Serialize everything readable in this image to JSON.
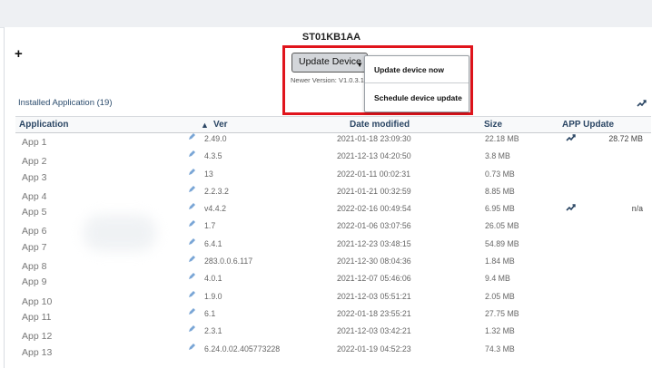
{
  "device": {
    "name": "ST01KB1AA"
  },
  "toolbar": {
    "add_label": "+"
  },
  "update": {
    "button_label": "Update Device",
    "newer_version": "Newer Version: V1.0.3.1",
    "menu_items": [
      "Update device now",
      "Schedule device update"
    ]
  },
  "installed": {
    "label": "Installed Application (19)"
  },
  "table": {
    "headers": {
      "application": "Application",
      "sort_indicator": "▲",
      "ver": "Ver",
      "date": "Date modified",
      "size": "Size",
      "app_update": "APP Update"
    },
    "rows": [
      {
        "app": "App 1",
        "ver": "2.49.0",
        "date": "2021-01-18 23:09:30",
        "size": "22.18 MB",
        "update": "28.72 MB",
        "trend": true
      },
      {
        "app": "App 2",
        "ver": "4.3.5",
        "date": "2021-12-13 04:20:50",
        "size": "3.8 MB"
      },
      {
        "app": "App 3",
        "ver": "13",
        "date": "2022-01-11 00:02:31",
        "size": "0.73 MB"
      },
      {
        "app": "App 4",
        "ver": "2.2.3.2",
        "date": "2021-01-21 00:32:59",
        "size": "8.85 MB"
      },
      {
        "app": "App 5",
        "ver": "v4.4.2",
        "date": "2022-02-16 00:49:54",
        "size": "6.95 MB",
        "update": "n/a",
        "trend": true
      },
      {
        "app": "App 6",
        "ver": "1.7",
        "date": "2022-01-06 03:07:56",
        "size": "26.05 MB"
      },
      {
        "app": "App 7",
        "ver": "6.4.1",
        "date": "2021-12-23 03:48:15",
        "size": "54.89 MB"
      },
      {
        "app": "App 8",
        "ver": "283.0.0.6.117",
        "date": "2021-12-30 08:04:36",
        "size": "1.84 MB"
      },
      {
        "app": "App 9",
        "ver": "4.0.1",
        "date": "2021-12-07 05:46:06",
        "size": "9.4 MB"
      },
      {
        "app": "App 10",
        "ver": "1.9.0",
        "date": "2021-12-03 05:51:21",
        "size": "2.05 MB"
      },
      {
        "app": "App 11",
        "ver": "6.1",
        "date": "2022-01-18 23:55:21",
        "size": "27.75 MB"
      },
      {
        "app": "App 12",
        "ver": "2.3.1",
        "date": "2021-12-03 03:42:21",
        "size": "1.32 MB"
      },
      {
        "app": "App 13",
        "ver": "6.24.0.02.405773228",
        "date": "2022-01-19 04:52:23",
        "size": "74.3 MB"
      }
    ]
  },
  "colors": {
    "highlight": "#e0141c",
    "header_text": "#2b4664",
    "pen_icon": "#7aa6d6"
  },
  "icons": {
    "row_edit": "pencil-icon",
    "trend": "trend-chart-icon"
  }
}
